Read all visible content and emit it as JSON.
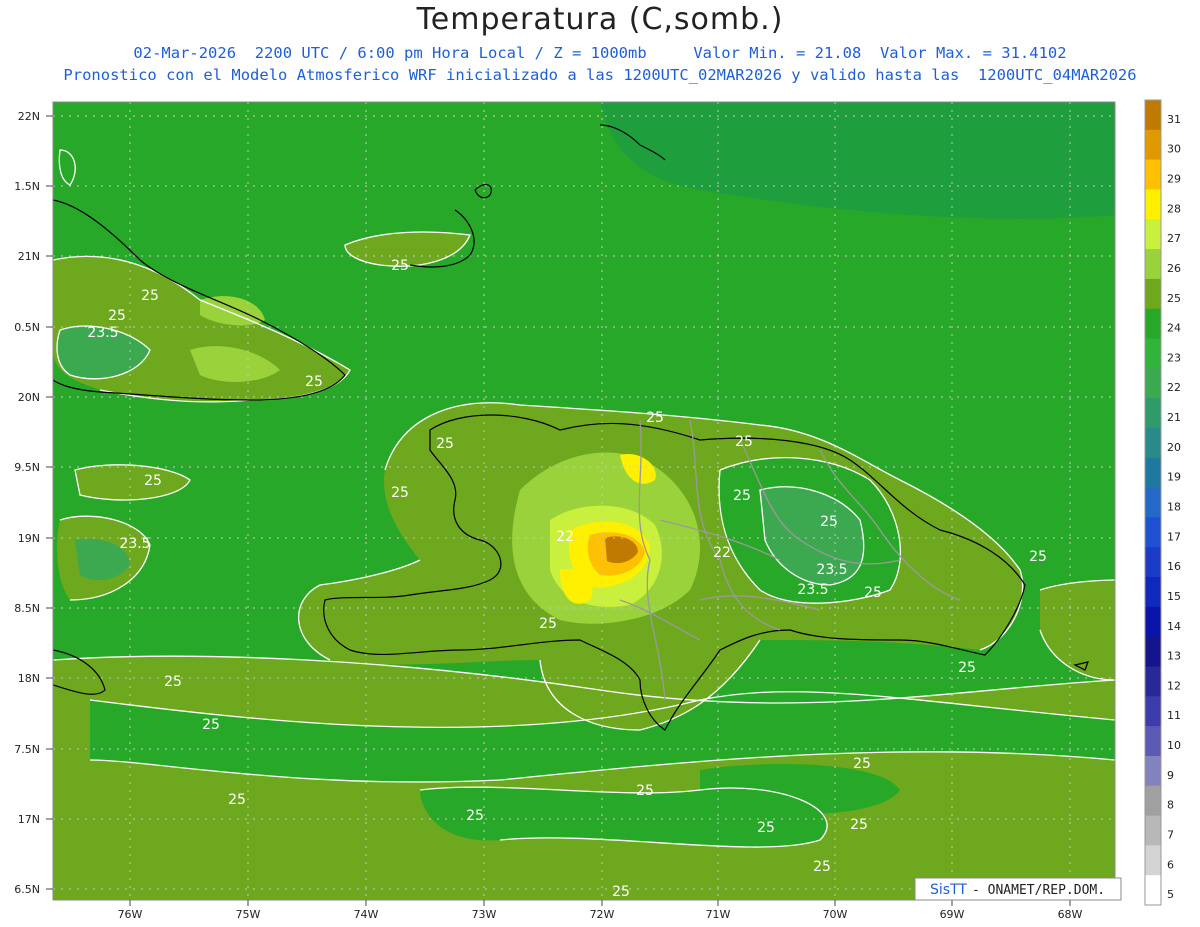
{
  "header": {
    "title": "Temperatura (C,somb.)",
    "line1": "02-Mar-2026  2200 UTC / 6:00 pm Hora Local / Z = 1000mb     Valor Min. = 21.08  Valor Max. = 31.4102",
    "line2": "Pronostico con el Modelo Atmosferico WRF inicializado a las 1200UTC_02MAR2026 y valido hasta las  1200UTC_04MAR2026"
  },
  "axes": {
    "lat_labels": [
      "22N",
      "1.5N",
      "21N",
      "0.5N",
      "20N",
      "9.5N",
      "19N",
      "8.5N",
      "18N",
      "7.5N",
      "17N",
      "6.5N"
    ],
    "lon_labels": [
      "76W",
      "75W",
      "74W",
      "73W",
      "72W",
      "71W",
      "70W",
      "69W",
      "68W"
    ]
  },
  "colorbar": {
    "labels": [
      "31",
      "30",
      "29",
      "28",
      "27",
      "26",
      "25",
      "24",
      "23",
      "22",
      "21",
      "20",
      "19",
      "18",
      "17",
      "16",
      "15",
      "14",
      "13",
      "12",
      "11",
      "10",
      "9",
      "8",
      "7",
      "6",
      "5"
    ],
    "colors": [
      "#c07a00",
      "#e09a00",
      "#ffc000",
      "#fff000",
      "#c8f03c",
      "#9ad23c",
      "#6ea81e",
      "#28a828",
      "#32b43c",
      "#3ca850",
      "#2f9a6a",
      "#2a8a8a",
      "#1f78a0",
      "#2468c8",
      "#1e50d2",
      "#1a3cc8",
      "#0f28be",
      "#0a14aa",
      "#14148c",
      "#282896",
      "#3c3caa",
      "#5a5ab4",
      "#8282be",
      "#a0a0a0",
      "#b8b8b8",
      "#d4d4d4",
      "#ffffff"
    ]
  },
  "credit": {
    "logo": "SisTT",
    "text": " - ONAMET/REP.DOM."
  },
  "contour_labels": [
    "25",
    "25",
    "23.5",
    "25",
    "25",
    "25",
    "25",
    "23.5",
    "25",
    "25",
    "25",
    "25",
    "25",
    "23.5",
    "22",
    "22",
    "25",
    "23.5",
    "25",
    "25",
    "25",
    "25",
    "25",
    "25",
    "25",
    "25",
    "25",
    "25",
    "25",
    "25",
    "25"
  ],
  "colors": {
    "sea": "#28a828",
    "land_warm": "#6ea81e",
    "accent": "#1f5fd6"
  }
}
